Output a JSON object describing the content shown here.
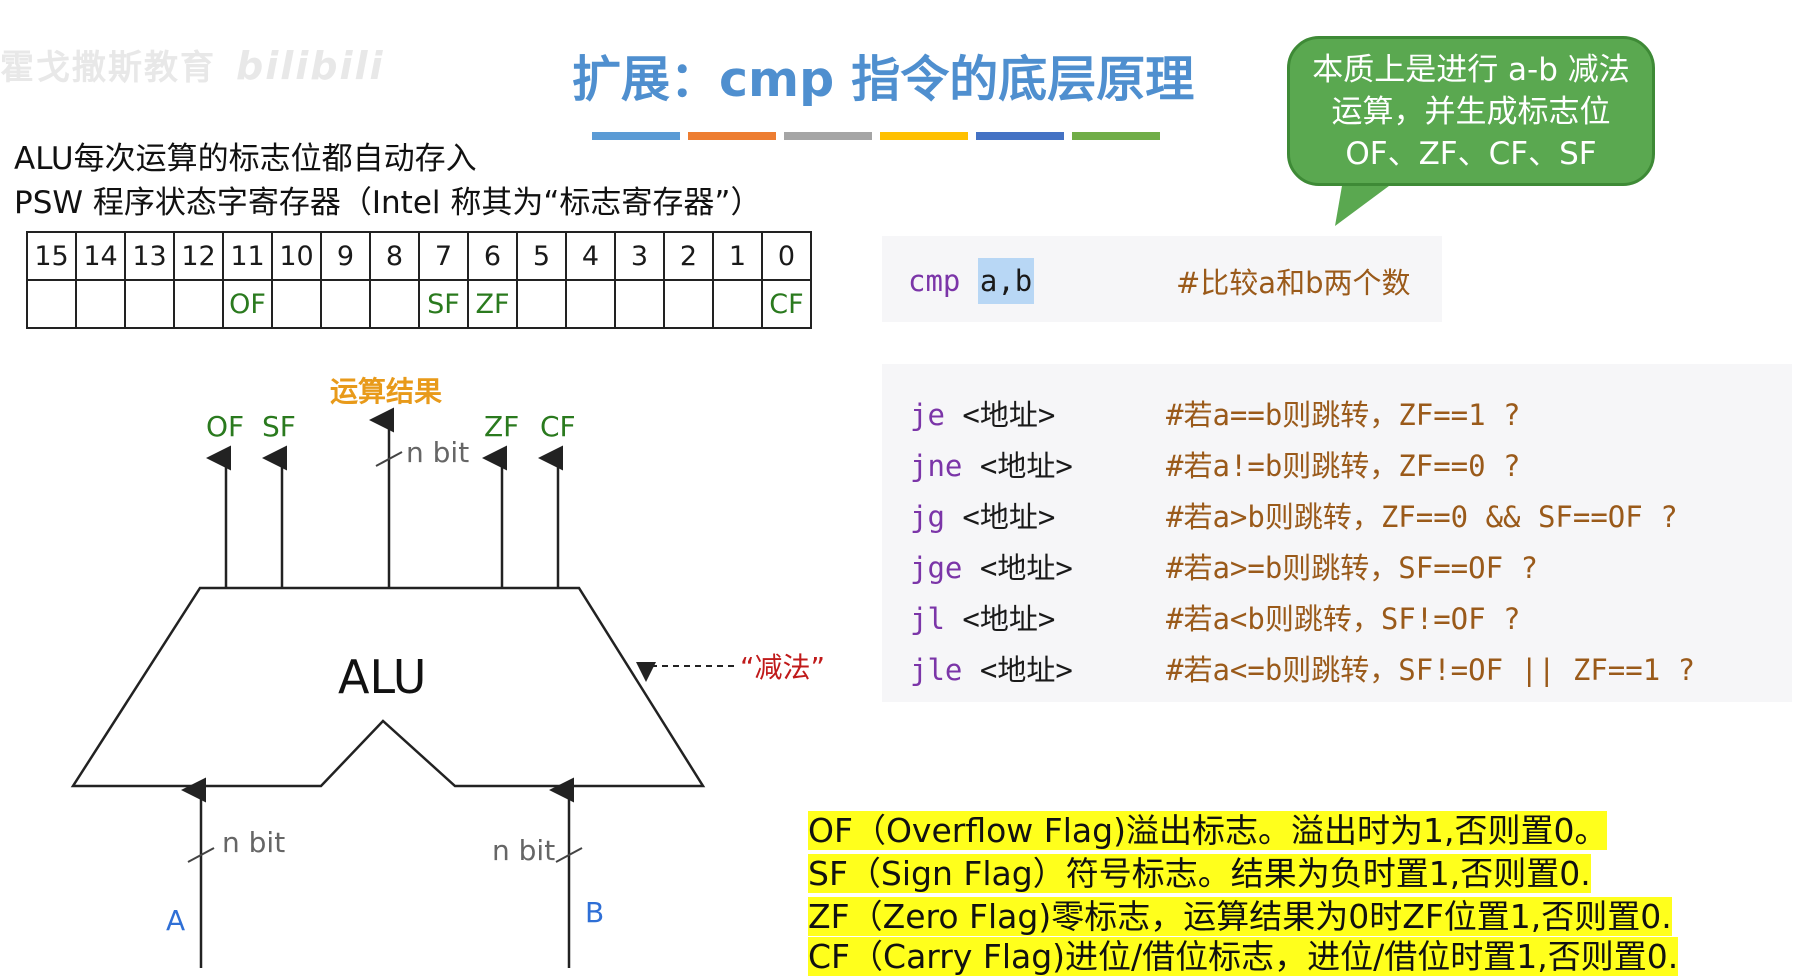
{
  "watermark": {
    "text": "霍戈撒斯教育",
    "brand": "bilibili"
  },
  "title": "扩展：cmp 指令的底层原理",
  "title_bar_colors": [
    "#5b9bd5",
    "#ed7d31",
    "#a5a5a5",
    "#ffc000",
    "#4472c4",
    "#70ad47"
  ],
  "bubble": {
    "text": "本质上是进行 a-b 减法运算，并生成标志位OF、ZF、CF、SF"
  },
  "intro": {
    "line1": "ALU每次运算的标志位都自动存入",
    "line2": "PSW 程序状态字寄存器（Intel 称其为“标志寄存器”）"
  },
  "register": {
    "bits": [
      "15",
      "14",
      "13",
      "12",
      "11",
      "10",
      "9",
      "8",
      "7",
      "6",
      "5",
      "4",
      "3",
      "2",
      "1",
      "0"
    ],
    "flags": [
      "",
      "",
      "",
      "",
      "OF",
      "",
      "",
      "",
      "SF",
      "ZF",
      "",
      "",
      "",
      "",
      "",
      "CF"
    ]
  },
  "cmp": {
    "keyword": "cmp",
    "operands": "a,b",
    "comment": "#比较a和b两个数"
  },
  "jumps": [
    {
      "keyword": "je",
      "target": "<地址>",
      "comment": "#若a==b则跳转，ZF==1 ?"
    },
    {
      "keyword": "jne",
      "target": "<地址>",
      "comment": "#若a!=b则跳转，ZF==0 ?"
    },
    {
      "keyword": "jg",
      "target": "<地址>",
      "comment": "#若a>b则跳转，ZF==0 && SF==OF ?"
    },
    {
      "keyword": "jge",
      "target": "<地址>",
      "comment": "#若a>=b则跳转，SF==OF ?"
    },
    {
      "keyword": "jl",
      "target": "<地址>",
      "comment": "#若a<b则跳转，SF!=OF ?"
    },
    {
      "keyword": "jle",
      "target": "<地址>",
      "comment": "#若a<=b则跳转，SF!=OF || ZF==1 ?"
    }
  ],
  "diagram": {
    "alu_label": "ALU",
    "result_label": "运算结果",
    "top_flags": {
      "of": "OF",
      "sf": "SF",
      "zf": "ZF",
      "cf": "CF"
    },
    "bit_label": "n bit",
    "input_a": "A",
    "input_b": "B",
    "subtract_label": "“减法”"
  },
  "flag_descriptions": [
    "OF（Overflow Flag)溢出标志。溢出时为1,否则置0。",
    "SF（Sign Flag）符号标志。结果为负时置1,否则置0.",
    "ZF（Zero Flag)零标志，运算结果为0时ZF位置1,否则置0.",
    "CF（Carry Flag)进位/借位标志，进位/借位时置1,否则置0."
  ]
}
